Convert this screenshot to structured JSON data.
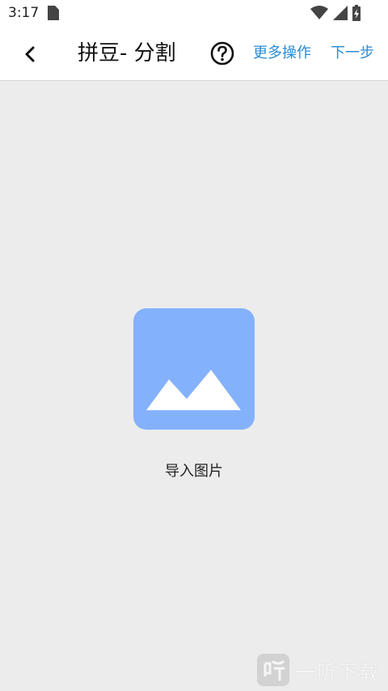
{
  "status_bar": {
    "time": "3:17"
  },
  "header": {
    "title": "拼豆- 分割",
    "more_actions": "更多操作",
    "next_step": "下一步"
  },
  "main": {
    "import_label": "导入图片"
  },
  "watermark": {
    "text": "一听下载"
  },
  "colors": {
    "accent": "#2a8bd3",
    "tile": "#84b1fc",
    "background": "#ececec"
  },
  "icons": {
    "back": "chevron-left-icon",
    "help": "help-circle-icon",
    "import": "image-icon"
  }
}
